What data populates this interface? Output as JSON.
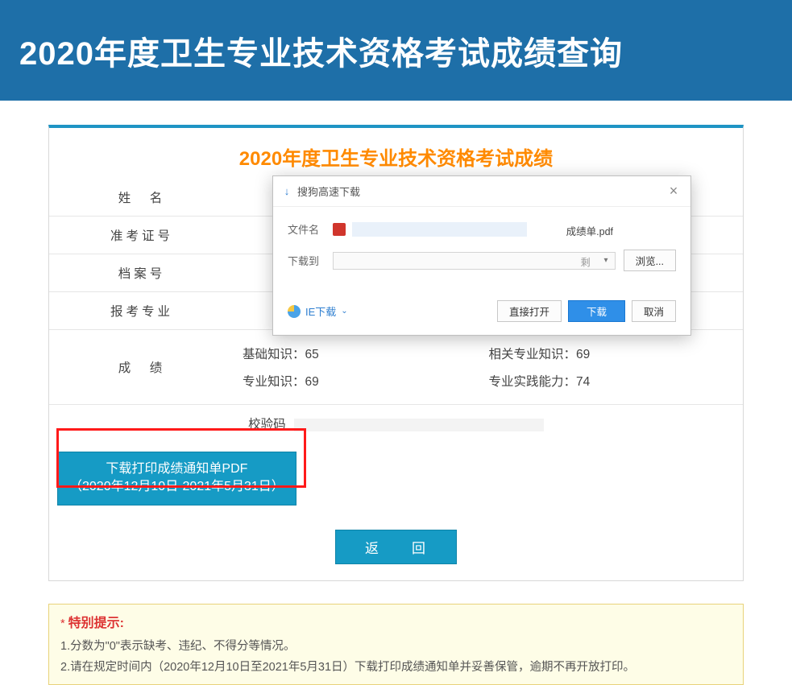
{
  "header": {
    "title": "2020年度卫生专业技术资格考试成绩查询"
  },
  "card": {
    "title": "2020年度卫生专业技术资格考试成绩",
    "labels": {
      "name": "姓　名",
      "ticket": "准考证号",
      "file": "档案号",
      "major": "报考专业",
      "score": "成　绩",
      "checkcode": "校验码"
    },
    "scores": {
      "basic": "基础知识：65",
      "related": "相关专业知识：69",
      "pro": "专业知识：69",
      "practice": "专业实践能力：74"
    },
    "download_btn_l1": "下载打印成绩通知单PDF",
    "download_btn_l2": "（2020年12月10日-2021年5月31日）",
    "back_btn": "返　回"
  },
  "notice": {
    "title": "特别提示:",
    "star": "* ",
    "item1": "1.分数为\"0\"表示缺考、违纪、不得分等情况。",
    "item2": "2.请在规定时间内（2020年12月10日至2021年5月31日）下载打印成绩通知单并妥善保管，逾期不再开放打印。"
  },
  "dialog": {
    "title": "搜狗高速下载",
    "filename_label": "文件名",
    "filename_suffix": "成绩单.pdf",
    "saveto_label": "下载到",
    "remain_prefix": "剩",
    "browse": "浏览...",
    "ie_link": "IE下载",
    "open": "直接打开",
    "download": "下载",
    "cancel": "取消"
  }
}
